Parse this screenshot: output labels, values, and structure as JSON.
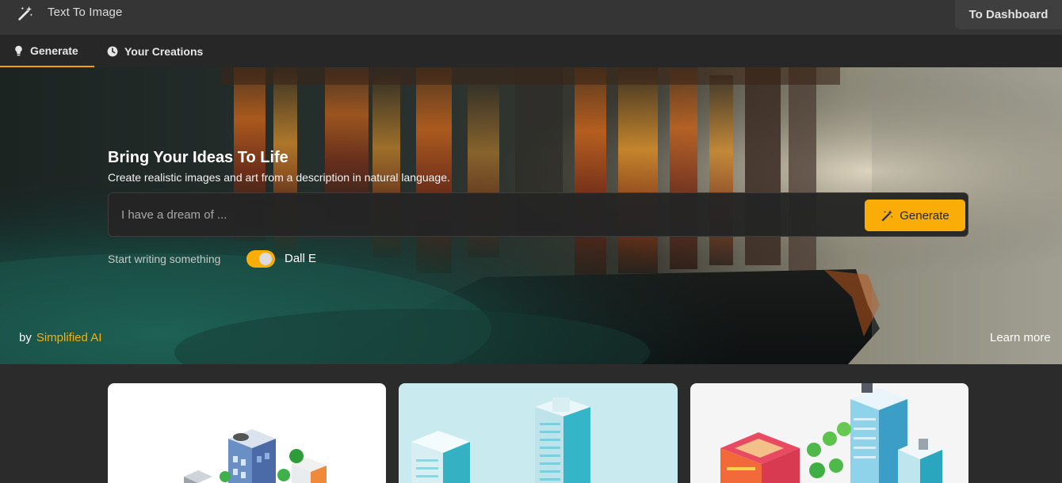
{
  "app": {
    "title": "Text To Image",
    "icon": "magic-wand-icon",
    "dashboard_label": "To Dashboard"
  },
  "tabs": [
    {
      "label": "Generate",
      "icon": "lightbulb-icon",
      "active": true
    },
    {
      "label": "Your Creations",
      "icon": "clock-icon",
      "active": false
    }
  ],
  "hero": {
    "title": "Bring Your Ideas To Life",
    "subtitle": "Create realistic images and art from a description in natural language.",
    "prompt_placeholder": "I have a dream of ...",
    "prompt_value": "",
    "generate_label": "Generate",
    "hint": "Start writing something",
    "toggle_label": "Dall E",
    "toggle_on": true,
    "by_label": "by",
    "brand": "Simplified AI",
    "learn_more": "Learn more"
  },
  "colors": {
    "accent": "#f9ad06",
    "background": "#2b2b2b",
    "topbar": "#353535"
  },
  "gallery": [
    {
      "name": "isometric-city-white"
    },
    {
      "name": "isometric-city-teal"
    },
    {
      "name": "isometric-city-light"
    }
  ]
}
